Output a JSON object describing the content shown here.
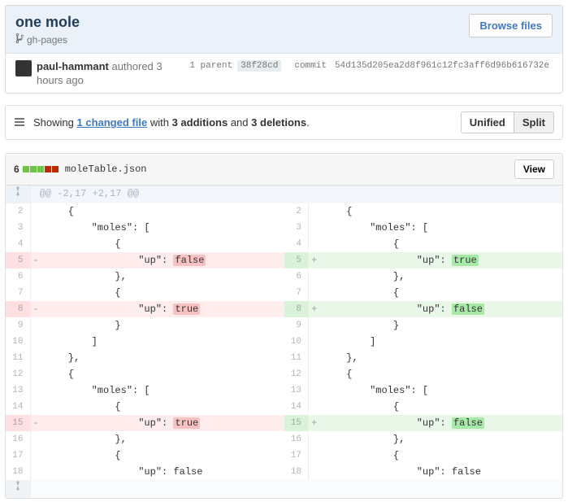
{
  "commit": {
    "title": "one mole",
    "branch": "gh-pages",
    "browse_btn": "Browse files",
    "author_name": "paul-hammant",
    "author_suffix": "authored",
    "author_time": "3 hours ago",
    "parent_label": "1 parent",
    "parent_sha": "38f28cd",
    "commit_label": "commit",
    "commit_sha": "54d135d205ea2d8f961c12fc3aff6d96b616732e"
  },
  "summary": {
    "prefix": "Showing",
    "files_link": "1 changed file",
    "mid": "with",
    "add_count": "3 additions",
    "and": "and",
    "del_count": "3 deletions",
    "period": ".",
    "unified": "Unified",
    "split": "Split"
  },
  "file": {
    "diff_count": "6",
    "name": "moleTable.json",
    "view_btn": "View",
    "hunk_header": "@@ -2,17 +2,17 @@"
  },
  "rows": [
    {
      "type": "ctx",
      "ln": "2",
      "lcode": "    {",
      "rn": "2",
      "rcode": "    {"
    },
    {
      "type": "ctx",
      "ln": "3",
      "lcode": "        \"moles\": [",
      "rn": "3",
      "rcode": "        \"moles\": ["
    },
    {
      "type": "ctx",
      "ln": "4",
      "lcode": "            {",
      "rn": "4",
      "rcode": "            {"
    },
    {
      "type": "chg",
      "ln": "5",
      "lcode": "                \"up\": ",
      "ltok": "false",
      "rn": "5",
      "rcode": "                \"up\": ",
      "rtok": "true"
    },
    {
      "type": "ctx",
      "ln": "6",
      "lcode": "            },",
      "rn": "6",
      "rcode": "            },"
    },
    {
      "type": "ctx",
      "ln": "7",
      "lcode": "            {",
      "rn": "7",
      "rcode": "            {"
    },
    {
      "type": "chg",
      "ln": "8",
      "lcode": "                \"up\": ",
      "ltok": "true",
      "rn": "8",
      "rcode": "                \"up\": ",
      "rtok": "false"
    },
    {
      "type": "ctx",
      "ln": "9",
      "lcode": "            }",
      "rn": "9",
      "rcode": "            }"
    },
    {
      "type": "ctx",
      "ln": "10",
      "lcode": "        ]",
      "rn": "10",
      "rcode": "        ]"
    },
    {
      "type": "ctx",
      "ln": "11",
      "lcode": "    },",
      "rn": "11",
      "rcode": "    },"
    },
    {
      "type": "ctx",
      "ln": "12",
      "lcode": "    {",
      "rn": "12",
      "rcode": "    {"
    },
    {
      "type": "ctx",
      "ln": "13",
      "lcode": "        \"moles\": [",
      "rn": "13",
      "rcode": "        \"moles\": ["
    },
    {
      "type": "ctx",
      "ln": "14",
      "lcode": "            {",
      "rn": "14",
      "rcode": "            {"
    },
    {
      "type": "chg",
      "ln": "15",
      "lcode": "                \"up\": ",
      "ltok": "true",
      "rn": "15",
      "rcode": "                \"up\": ",
      "rtok": "false"
    },
    {
      "type": "ctx",
      "ln": "16",
      "lcode": "            },",
      "rn": "16",
      "rcode": "            },"
    },
    {
      "type": "ctx",
      "ln": "17",
      "lcode": "            {",
      "rn": "17",
      "rcode": "            {"
    },
    {
      "type": "ctx",
      "ln": "18",
      "lcode": "                \"up\": false",
      "rn": "18",
      "rcode": "                \"up\": false"
    }
  ]
}
